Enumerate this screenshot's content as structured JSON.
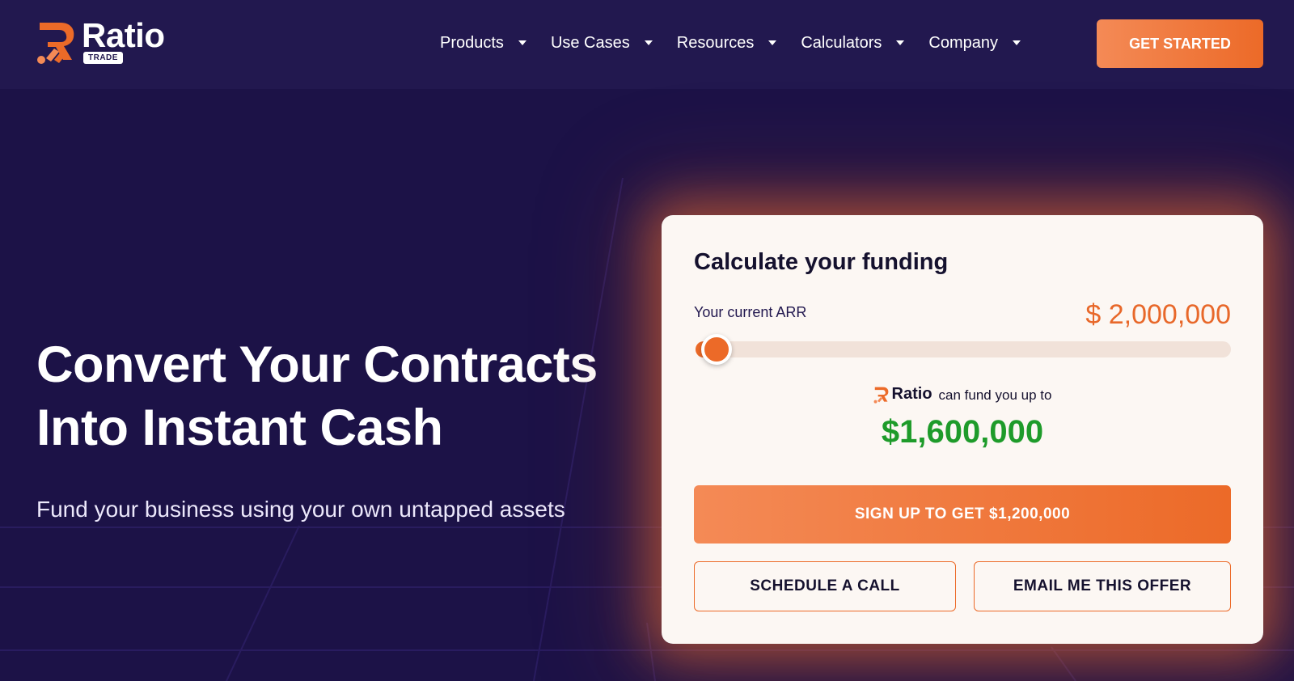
{
  "header": {
    "logo": {
      "name": "Ratio",
      "badge": "TRADE"
    },
    "nav": [
      {
        "label": "Products"
      },
      {
        "label": "Use Cases"
      },
      {
        "label": "Resources"
      },
      {
        "label": "Calculators"
      },
      {
        "label": "Company"
      }
    ],
    "cta_label": "GET STARTED"
  },
  "hero": {
    "title_line1": "Convert Your Contracts",
    "title_line2": "Into Instant Cash",
    "subtitle": "Fund your business using your own untapped assets"
  },
  "calculator": {
    "title": "Calculate your funding",
    "arr_label": "Your current ARR",
    "arr_value": "$ 2,000,000",
    "slider_fraction": 0.04,
    "fund_brand": "Ratio",
    "fund_text": "can fund you up to",
    "fund_amount": "$1,600,000",
    "signup_label": "SIGN UP TO GET $1,200,000",
    "schedule_label": "SCHEDULE A CALL",
    "email_label": "EMAIL ME THIS OFFER"
  },
  "colors": {
    "background": "#1c1247",
    "header": "#22184f",
    "accent": "#ec6a28",
    "fund_green": "#1e9b2a",
    "card": "#fcf7f3"
  },
  "icons": [
    "ratio-logo-icon",
    "chevron-down-icon"
  ]
}
